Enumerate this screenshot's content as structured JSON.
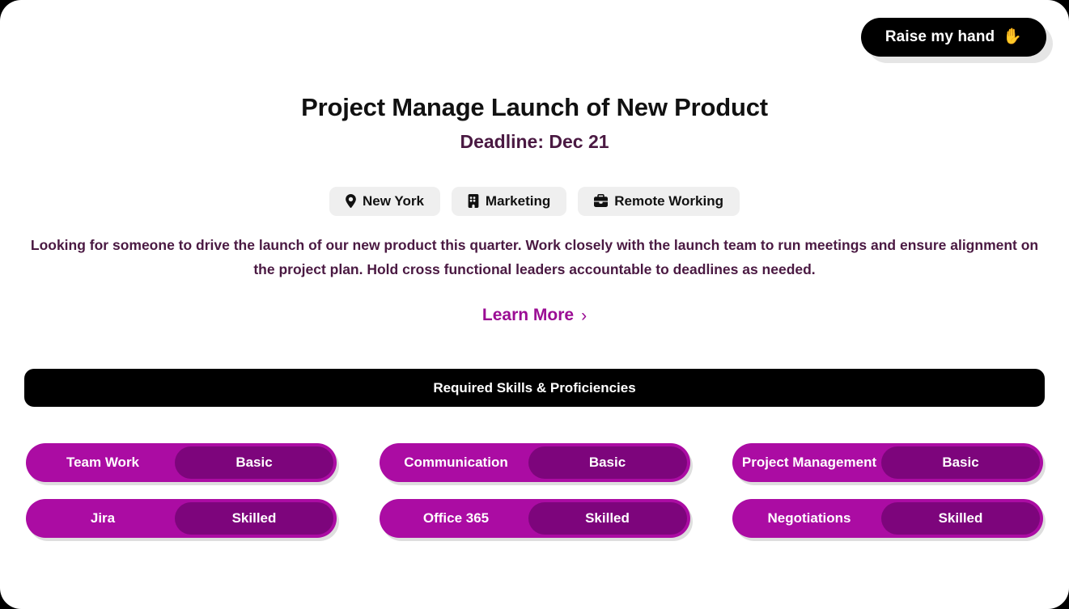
{
  "header": {
    "raise_hand_label": "Raise my hand",
    "raise_hand_icon": "raised-hand-emoji"
  },
  "job": {
    "title": "Project Manage Launch of New Product",
    "deadline": "Deadline: Dec 21",
    "tags": [
      {
        "label": "New York",
        "icon": "location-pin-icon"
      },
      {
        "label": "Marketing",
        "icon": "building-icon"
      },
      {
        "label": "Remote Working",
        "icon": "briefcase-icon"
      }
    ],
    "description": "Looking for someone to drive the launch of our new product this quarter. Work closely with the launch team to run meetings and ensure alignment on the project plan. Hold cross functional leaders accountable to deadlines as needed.",
    "learn_more_label": "Learn More",
    "learn_more_chevron": "›"
  },
  "skills_section": {
    "banner_title": "Required Skills & Proficiencies",
    "skills": [
      {
        "name": "Team Work",
        "level": "Basic"
      },
      {
        "name": "Communication",
        "level": "Basic"
      },
      {
        "name": "Project Management",
        "level": "Basic"
      },
      {
        "name": "Jira",
        "level": "Skilled"
      },
      {
        "name": "Office 365",
        "level": "Skilled"
      },
      {
        "name": "Negotiations",
        "level": "Skilled"
      }
    ]
  },
  "colors": {
    "magenta": "#ab0ca3",
    "dark_purple": "#7d057c",
    "text_purple": "#4a1942",
    "link_purple": "#9b0d94",
    "banner_black": "#000000"
  }
}
